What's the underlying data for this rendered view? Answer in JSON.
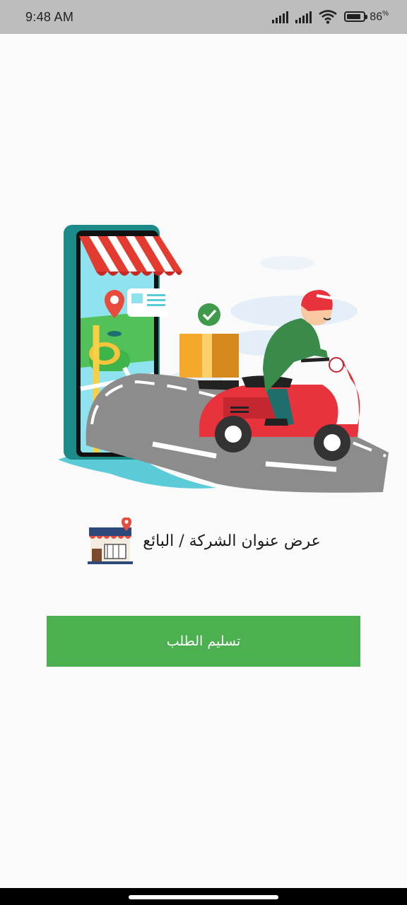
{
  "status_bar": {
    "time": "9:48 AM",
    "battery_percent": "86",
    "battery_suffix": "%",
    "battery_level": 0.86,
    "icons": [
      "signal-icon",
      "signal-icon",
      "wifi-icon",
      "battery-icon"
    ]
  },
  "illustration": {
    "icon": "delivery-scooter-illustration"
  },
  "address": {
    "label": "عرض عنوان الشركة / البائع",
    "icon": "store-location-icon"
  },
  "actions": {
    "deliver_label": "تسليم الطلب",
    "deliver_color": "#4caf50"
  }
}
